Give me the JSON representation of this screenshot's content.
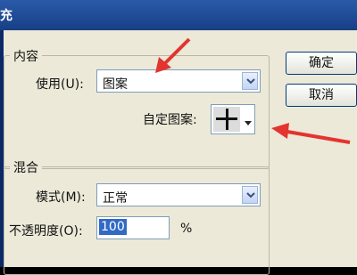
{
  "window": {
    "title": "充"
  },
  "content_group": {
    "legend": "内容",
    "use_label": "使用(U):",
    "use_value": "图案",
    "custom_pattern_label": "自定图案:"
  },
  "blend_group": {
    "legend": "混合",
    "mode_label": "模式(M):",
    "mode_value": "正常",
    "opacity_label": "不透明度(O):",
    "opacity_value": "100",
    "opacity_unit": "%"
  },
  "buttons": {
    "ok": "确定",
    "cancel": "取消"
  },
  "colors": {
    "annotation": "#e3342f",
    "title_bar": "#1f4a97",
    "dialog_bg": "#ece9d8"
  }
}
